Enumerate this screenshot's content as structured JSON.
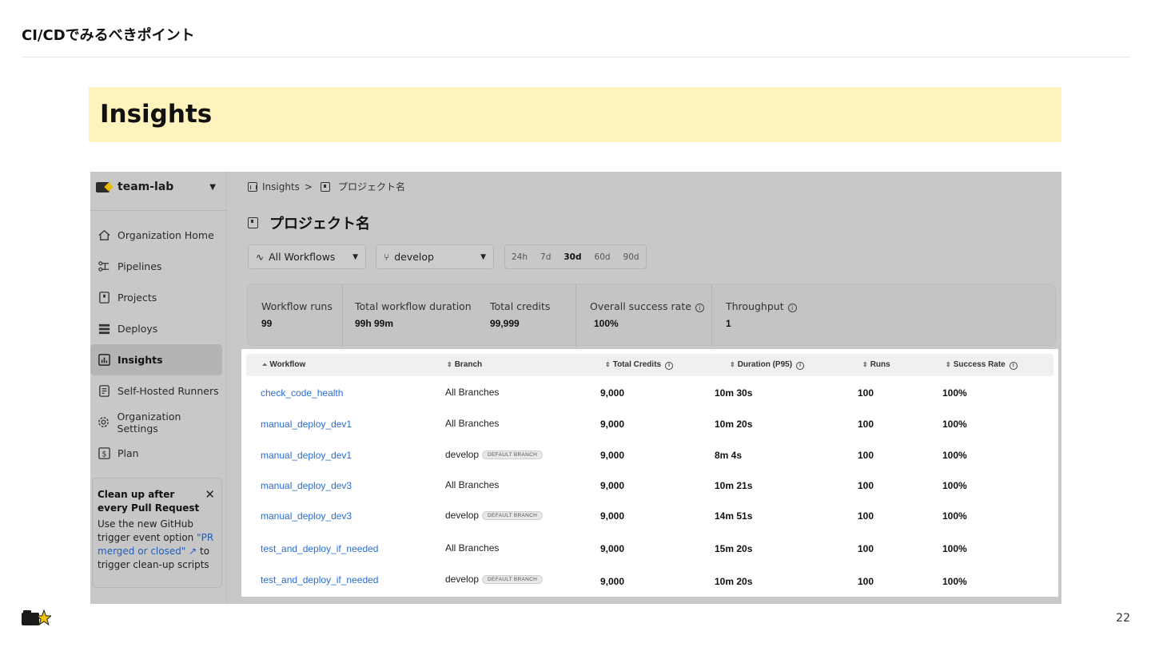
{
  "slide": {
    "title": "CI/CDでみるべきポイント",
    "banner_title": "Insights",
    "page_number": "22"
  },
  "sidebar": {
    "org_name": "team-lab",
    "items": [
      {
        "label": "Organization Home",
        "icon": "home-icon"
      },
      {
        "label": "Pipelines",
        "icon": "pipelines-icon"
      },
      {
        "label": "Projects",
        "icon": "project-icon"
      },
      {
        "label": "Deploys",
        "icon": "deploys-icon"
      },
      {
        "label": "Insights",
        "icon": "insights-icon",
        "active": true
      },
      {
        "label": "Self-Hosted Runners",
        "icon": "runners-icon"
      },
      {
        "label": "Organization Settings",
        "icon": "gear-icon"
      },
      {
        "label": "Plan",
        "icon": "dollar-icon"
      }
    ],
    "promo": {
      "title": "Clean up after every Pull Request",
      "body_before": "Use the new GitHub trigger event option ",
      "link": "\"PR merged or closed\" ↗",
      "body_after": " to trigger clean-up scripts"
    }
  },
  "breadcrumb": {
    "root": "Insights",
    "separator": ">",
    "project": "プロジェクト名"
  },
  "page_title": "プロジェクト名",
  "filters": {
    "workflow": "All Workflows",
    "branch": "develop",
    "ranges": [
      "24h",
      "7d",
      "30d",
      "60d",
      "90d"
    ],
    "selected_range": "30d"
  },
  "stats": [
    {
      "label": "Workflow runs",
      "value": "99"
    },
    {
      "label": "Total workflow duration",
      "value": "99h 99m"
    },
    {
      "label": "Total credits",
      "value": "99,999"
    },
    {
      "label": "Overall success rate",
      "value": "100%",
      "info": true
    },
    {
      "label": "Throughput",
      "value": "1",
      "info": true
    }
  ],
  "table": {
    "columns": [
      "Workflow",
      "Branch",
      "Total Credits",
      "Duration (P95)",
      "Runs",
      "Success Rate"
    ],
    "default_badge": "DEFAULT BRANCH",
    "rows": [
      {
        "workflow": "check_code_health",
        "branch": "All Branches",
        "default": false,
        "credits": "9,000",
        "duration": "10m 30s",
        "runs": "100",
        "success": "100%"
      },
      {
        "workflow": "manual_deploy_dev1",
        "branch": "All Branches",
        "default": false,
        "credits": "9,000",
        "duration": "10m 20s",
        "runs": "100",
        "success": "100%"
      },
      {
        "workflow": "manual_deploy_dev1",
        "branch": "develop",
        "default": true,
        "credits": "9,000",
        "duration": "8m 4s",
        "runs": "100",
        "success": "100%"
      },
      {
        "workflow": "manual_deploy_dev3",
        "branch": "All Branches",
        "default": false,
        "credits": "9,000",
        "duration": "10m 21s",
        "runs": "100",
        "success": "100%"
      },
      {
        "workflow": "manual_deploy_dev3",
        "branch": "develop",
        "default": true,
        "credits": "9,000",
        "duration": "14m 51s",
        "runs": "100",
        "success": "100%"
      },
      {
        "workflow": "test_and_deploy_if_needed",
        "branch": "All Branches",
        "default": false,
        "credits": "9,000",
        "duration": "15m 20s",
        "runs": "100",
        "success": "100%"
      },
      {
        "workflow": "test_and_deploy_if_needed",
        "branch": "develop",
        "default": true,
        "credits": "9,000",
        "duration": "10m 20s",
        "runs": "100",
        "success": "100%"
      }
    ]
  },
  "colors": {
    "banner": "#fef3bd",
    "link": "#2a6dd4",
    "overlay": "#c8c8c8"
  },
  "footer": {
    "logo": "teamlab-logo-icon"
  }
}
